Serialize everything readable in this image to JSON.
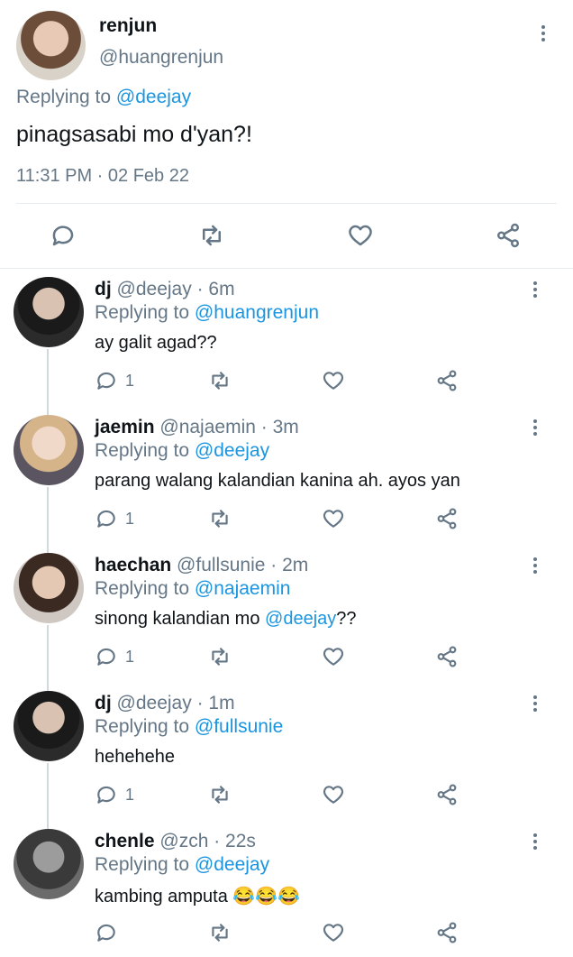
{
  "main_tweet": {
    "name": "renjun",
    "handle": "@huangrenjun",
    "replying_prefix": "Replying to",
    "replying_to": "@deejay",
    "text": "pinagsasabi mo d'yan?!",
    "timestamp": "11:31 PM · 02 Feb 22"
  },
  "replies": [
    {
      "name": "dj",
      "handle": "@deejay",
      "time": "· 6m",
      "replying_prefix": "Replying to",
      "replying_to": "@huangrenjun",
      "text": "ay galit agad??",
      "text_mention": "",
      "text_suffix": "",
      "reply_count": "1"
    },
    {
      "name": "jaemin",
      "handle": "@najaemin",
      "time": "· 3m",
      "replying_prefix": "Replying to",
      "replying_to": "@deejay",
      "text": "parang walang kalandian kanina ah. ayos yan",
      "text_mention": "",
      "text_suffix": "",
      "reply_count": "1"
    },
    {
      "name": "haechan",
      "handle": "@fullsunie",
      "time": "· 2m",
      "replying_prefix": "Replying to",
      "replying_to": "@najaemin",
      "text": "sinong kalandian mo ",
      "text_mention": "@deejay",
      "text_suffix": "??",
      "reply_count": "1"
    },
    {
      "name": "dj",
      "handle": "@deejay",
      "time": "· 1m",
      "replying_prefix": "Replying to",
      "replying_to": "@fullsunie",
      "text": "hehehehe",
      "text_mention": "",
      "text_suffix": "",
      "reply_count": "1"
    },
    {
      "name": "chenle",
      "handle": "@zch",
      "time": "· 22s",
      "replying_prefix": "Replying to",
      "replying_to": "@deejay",
      "text": "kambing amputa 😂😂😂",
      "text_mention": "",
      "text_suffix": "",
      "reply_count": ""
    }
  ],
  "icons": {
    "reply": "comment-icon",
    "retweet": "retweet-icon",
    "like": "heart-icon",
    "share": "share-icon",
    "more": "more-vertical-icon"
  },
  "colors": {
    "link": "#1b95e0",
    "muted": "#657786",
    "text": "#0f1419",
    "divider": "#e6ecf0"
  }
}
